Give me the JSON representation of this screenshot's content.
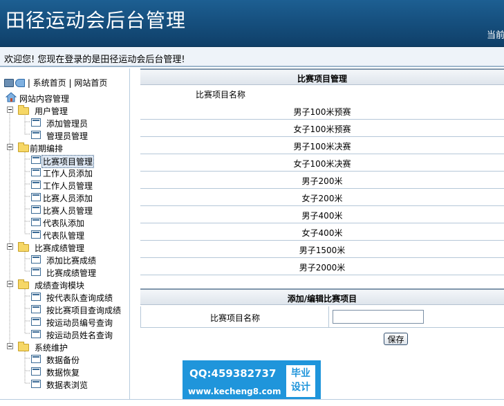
{
  "header": {
    "title": "田径运动会后台管理",
    "current_position": "当前"
  },
  "welcome": "欢迎您! 您现在登录的是田径运动会后台管理!",
  "sidebar": {
    "top_links": [
      "| 系统首页",
      "| 网站首页"
    ],
    "root": "网站内容管理",
    "groups": [
      {
        "label": "用户管理",
        "items": [
          "添加管理员",
          "管理员管理"
        ]
      },
      {
        "label": "前期编排",
        "items": [
          "比赛项目管理",
          "工作人员添加",
          "工作人员管理",
          "比赛人员添加",
          "比赛人员管理",
          "代表队添加",
          "代表队管理"
        ]
      },
      {
        "label": "比赛成绩管理",
        "items": [
          "添加比赛成绩",
          "比赛成绩管理"
        ]
      },
      {
        "label": "成绩查询模块",
        "items": [
          "按代表队查询成绩",
          "按比赛项目查询成绩",
          "按运动员编号查询",
          "按运动员姓名查询"
        ]
      },
      {
        "label": "系统维护",
        "items": [
          "数据备份",
          "数据恢复",
          "数据表浏览"
        ]
      }
    ],
    "selected": "比赛项目管理"
  },
  "events_panel": {
    "title": "比赛项目管理",
    "column_header": "比赛项目名称",
    "rows": [
      "男子100米预赛",
      "女子100米预赛",
      "男子100米决赛",
      "女子100米决赛",
      "男子200米",
      "女子200米",
      "男子400米",
      "女子400米",
      "男子1500米",
      "男子2000米"
    ]
  },
  "edit_panel": {
    "title": "添加/编辑比赛项目",
    "field_label": "比赛项目名称",
    "field_value": "",
    "save_label": "保存"
  },
  "watermark": {
    "qq": "QQ:459382737",
    "site": "www.kecheng8.com",
    "badge_line1": "毕业",
    "badge_line2": "设计"
  },
  "colors": {
    "header_blue": "#16507f",
    "watermark_blue": "#1f95db"
  }
}
